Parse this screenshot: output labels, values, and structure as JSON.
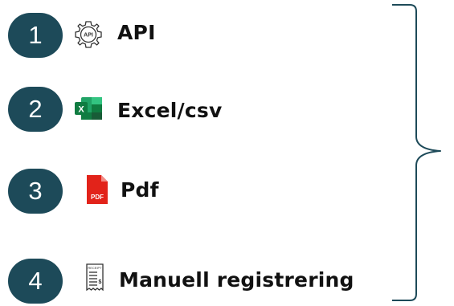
{
  "steps": [
    {
      "number": "1",
      "label": "API",
      "icon": "api-gear-icon"
    },
    {
      "number": "2",
      "label": "Excel/csv",
      "icon": "excel-icon"
    },
    {
      "number": "3",
      "label": "Pdf",
      "icon": "pdf-icon"
    },
    {
      "number": "4",
      "label": "Manuell registrering",
      "icon": "receipt-icon"
    }
  ],
  "icon_text": {
    "api": "API",
    "excel": "X",
    "pdf": "PDF",
    "receipt_header": "RECEIPT",
    "receipt_currency": "$"
  },
  "colors": {
    "badge": "#1d4a59",
    "badge_text": "#ffffff",
    "label": "#111111",
    "brace": "#1d4a59",
    "excel_green": "#21a366",
    "pdf_red": "#e2231a"
  }
}
